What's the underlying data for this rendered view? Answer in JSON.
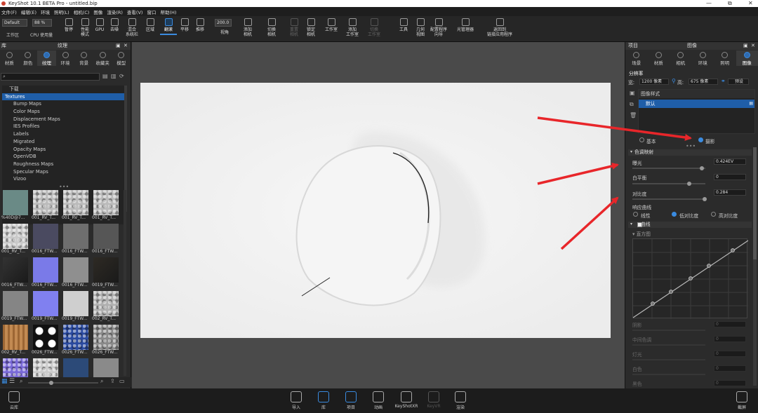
{
  "app": {
    "title": "KeyShot 10.1 BETA Pro  - untitled.bip",
    "window_controls": [
      "—",
      "⧉",
      "✕"
    ]
  },
  "menu": [
    "文件(F)",
    "编辑(E)",
    "环境",
    "照明(L)",
    "相机(C)",
    "图像",
    "渲染(R)",
    "查看(V)",
    "窗口",
    "帮助(H)"
  ],
  "toolbar": {
    "workspace_select": "Default",
    "workspace_label": "工作区",
    "cpu_select": "88 %",
    "cpu_label": "CPU 使用量",
    "zoom_value": "200.0",
    "buttons": [
      {
        "id": "pause",
        "label": "暂停"
      },
      {
        "id": "perf",
        "label": "性能\n模式"
      },
      {
        "id": "gpu",
        "label": "GPU"
      },
      {
        "id": "denoise",
        "label": "去噪"
      },
      {
        "id": "mix",
        "label": "混合\n系统栏"
      },
      {
        "id": "region",
        "label": "区域"
      },
      {
        "id": "flip",
        "label": "翻滚"
      },
      {
        "id": "pan",
        "label": "平移"
      },
      {
        "id": "push",
        "label": "推移"
      },
      {
        "id": "fov",
        "label": "视角"
      },
      {
        "id": "add-cam",
        "label": "添加\n相机"
      },
      {
        "id": "switch-cam",
        "label": "切换\n相机"
      },
      {
        "id": "reset-cam",
        "label": "重置\n相机"
      },
      {
        "id": "lock-cam",
        "label": "锁定\n相机"
      },
      {
        "id": "studio",
        "label": "工作室"
      },
      {
        "id": "add-studio",
        "label": "添加\n工作室"
      },
      {
        "id": "switch-studio",
        "label": "切换\n工作室"
      },
      {
        "id": "tools",
        "label": "工具"
      },
      {
        "id": "geo-view",
        "label": "几何\n视图"
      },
      {
        "id": "config",
        "label": "配置程序\n向导"
      },
      {
        "id": "light-mgr",
        "label": "光管理器"
      },
      {
        "id": "back",
        "label": "返回到\n链接应用程序"
      }
    ]
  },
  "left": {
    "header": "纹理",
    "tabs": [
      "材质",
      "颜色",
      "纹理",
      "环境",
      "背景",
      "收藏夹",
      "模型"
    ],
    "tree": [
      {
        "label": "下载",
        "indent": 1
      },
      {
        "label": "Textures",
        "indent": 0,
        "selected": true
      },
      {
        "label": "Bump Maps",
        "indent": 2
      },
      {
        "label": "Color Maps",
        "indent": 2
      },
      {
        "label": "Displacement Maps",
        "indent": 2
      },
      {
        "label": "IES Profiles",
        "indent": 2
      },
      {
        "label": "Labels",
        "indent": 2
      },
      {
        "label": "Migrated",
        "indent": 2
      },
      {
        "label": "Opacity Maps",
        "indent": 2
      },
      {
        "label": "OpenVDB",
        "indent": 2
      },
      {
        "label": "Roughness Maps",
        "indent": 2
      },
      {
        "label": "Specular Maps",
        "indent": 2
      },
      {
        "label": "Vizoo",
        "indent": 2
      }
    ],
    "thumbs": [
      {
        "label": "%40D@7...",
        "c": "#6a8a86",
        "p": "flat"
      },
      {
        "label": "001_RV_T...",
        "c": "#bbbbbb",
        "p": "noise"
      },
      {
        "label": "001_RV_T...",
        "c": "#bbbbbb",
        "p": "noise"
      },
      {
        "label": "001_RV_T...",
        "c": "#bbbbbb",
        "p": "noise"
      },
      {
        "label": "001_RV_T...",
        "c": "#c9c9c9",
        "p": "noise"
      },
      {
        "label": "0016_FTW...",
        "c": "#4a4a60",
        "p": "flat"
      },
      {
        "label": "0016_FTW...",
        "c": "#6e6e6e",
        "p": "flat"
      },
      {
        "label": "0016_FTW...",
        "c": "#565656",
        "p": "flat"
      },
      {
        "label": "0016_FTW...",
        "c": "#333333",
        "p": "dark"
      },
      {
        "label": "0016_FTW...",
        "c": "#7a7ae8",
        "p": "flat"
      },
      {
        "label": "0016_FTW...",
        "c": "#8f8f8f",
        "p": "flat"
      },
      {
        "label": "0019_FTW...",
        "c": "#2e2a24",
        "p": "dark"
      },
      {
        "label": "0019_FTW...",
        "c": "#858585",
        "p": "flat"
      },
      {
        "label": "0019_FTW...",
        "c": "#8080f0",
        "p": "flat"
      },
      {
        "label": "0019_FTW...",
        "c": "#cfcfcf",
        "p": "flat"
      },
      {
        "label": "002_RV_T...",
        "c": "#b0b0b0",
        "p": "noise"
      },
      {
        "label": "002_RV_T...",
        "c": "#b07a45",
        "p": "wood"
      },
      {
        "label": "0026_FTW...",
        "c": "#111111",
        "p": "spots"
      },
      {
        "label": "0026_FTW...",
        "c": "#2a4aa0",
        "p": "noise"
      },
      {
        "label": "0026_FTW...",
        "c": "#8a8a8a",
        "p": "noise"
      },
      {
        "label": "",
        "c": "#7a6ad8",
        "p": "noise"
      },
      {
        "label": "",
        "c": "#cccccc",
        "p": "noise"
      },
      {
        "label": "",
        "c": "#2c4a78",
        "p": "flat"
      },
      {
        "label": "",
        "c": "#8a8a8a",
        "p": "flat"
      }
    ]
  },
  "right": {
    "header_left": "项目",
    "header": "图像",
    "tabs": [
      "场景",
      "材质",
      "相机",
      "环境",
      "照明",
      "图像"
    ],
    "resolution": {
      "title": "分辨率",
      "w_label": "宽:",
      "w_value": "1200 像素",
      "h_label": "高:",
      "h_value": "675 像素",
      "preset": "预设"
    },
    "style": {
      "title": "图像样式",
      "item": "默认"
    },
    "mode": {
      "basic": "基本",
      "photo": "摄影"
    },
    "tonemap": {
      "title": "色调映射",
      "exposure_label": "曝光",
      "exposure_value": "0.424EV",
      "wb_label": "白平衡",
      "wb_value": "0",
      "contrast_label": "对比度",
      "contrast_value": "0.284",
      "curve_label": "响应曲线",
      "curve_opts": [
        "线性",
        "低对比度",
        "高对比度"
      ]
    },
    "curves": {
      "title": "曲线",
      "sub": "直方图"
    },
    "dim_rows": [
      "阴影",
      "中间色调",
      "灯光",
      "白色",
      "黑色"
    ],
    "dim_value": "0"
  },
  "bottom": {
    "left": "云库",
    "buttons": [
      "导入",
      "库",
      "项目",
      "动画",
      "KeyShotXR",
      "KeyVR",
      "渲染"
    ],
    "right": "截屏"
  },
  "colors": {
    "accent": "#3a8be0",
    "selected": "#1f5ea8",
    "arrow": "#e8262a"
  }
}
